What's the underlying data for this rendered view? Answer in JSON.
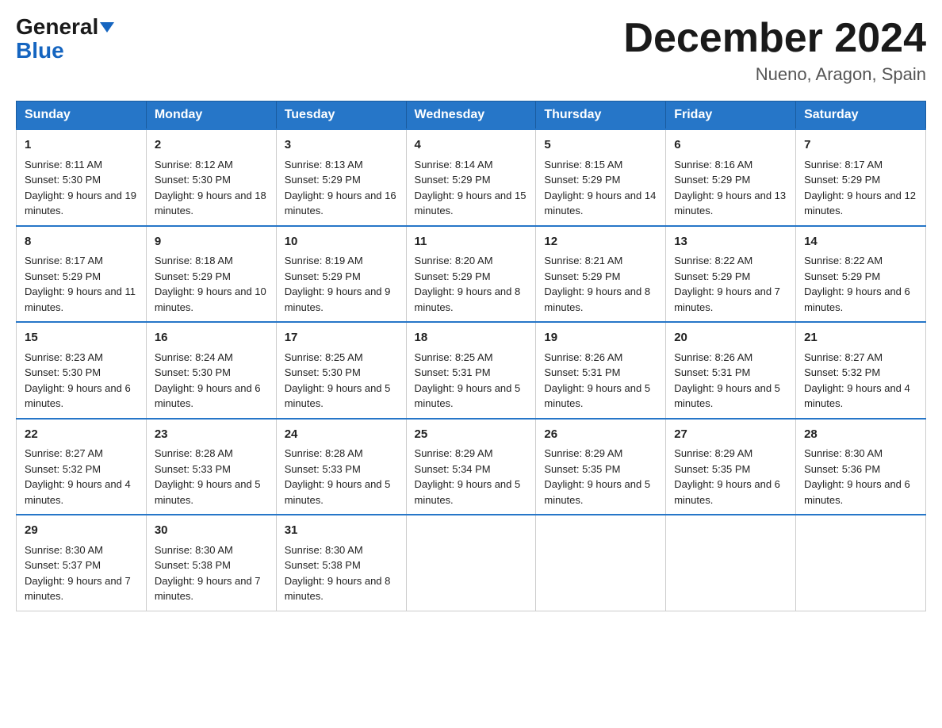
{
  "header": {
    "logo_general": "General",
    "logo_blue": "Blue",
    "title": "December 2024",
    "location": "Nueno, Aragon, Spain"
  },
  "days_of_week": [
    "Sunday",
    "Monday",
    "Tuesday",
    "Wednesday",
    "Thursday",
    "Friday",
    "Saturday"
  ],
  "weeks": [
    [
      {
        "day": "1",
        "sunrise": "Sunrise: 8:11 AM",
        "sunset": "Sunset: 5:30 PM",
        "daylight": "Daylight: 9 hours and 19 minutes."
      },
      {
        "day": "2",
        "sunrise": "Sunrise: 8:12 AM",
        "sunset": "Sunset: 5:30 PM",
        "daylight": "Daylight: 9 hours and 18 minutes."
      },
      {
        "day": "3",
        "sunrise": "Sunrise: 8:13 AM",
        "sunset": "Sunset: 5:29 PM",
        "daylight": "Daylight: 9 hours and 16 minutes."
      },
      {
        "day": "4",
        "sunrise": "Sunrise: 8:14 AM",
        "sunset": "Sunset: 5:29 PM",
        "daylight": "Daylight: 9 hours and 15 minutes."
      },
      {
        "day": "5",
        "sunrise": "Sunrise: 8:15 AM",
        "sunset": "Sunset: 5:29 PM",
        "daylight": "Daylight: 9 hours and 14 minutes."
      },
      {
        "day": "6",
        "sunrise": "Sunrise: 8:16 AM",
        "sunset": "Sunset: 5:29 PM",
        "daylight": "Daylight: 9 hours and 13 minutes."
      },
      {
        "day": "7",
        "sunrise": "Sunrise: 8:17 AM",
        "sunset": "Sunset: 5:29 PM",
        "daylight": "Daylight: 9 hours and 12 minutes."
      }
    ],
    [
      {
        "day": "8",
        "sunrise": "Sunrise: 8:17 AM",
        "sunset": "Sunset: 5:29 PM",
        "daylight": "Daylight: 9 hours and 11 minutes."
      },
      {
        "day": "9",
        "sunrise": "Sunrise: 8:18 AM",
        "sunset": "Sunset: 5:29 PM",
        "daylight": "Daylight: 9 hours and 10 minutes."
      },
      {
        "day": "10",
        "sunrise": "Sunrise: 8:19 AM",
        "sunset": "Sunset: 5:29 PM",
        "daylight": "Daylight: 9 hours and 9 minutes."
      },
      {
        "day": "11",
        "sunrise": "Sunrise: 8:20 AM",
        "sunset": "Sunset: 5:29 PM",
        "daylight": "Daylight: 9 hours and 8 minutes."
      },
      {
        "day": "12",
        "sunrise": "Sunrise: 8:21 AM",
        "sunset": "Sunset: 5:29 PM",
        "daylight": "Daylight: 9 hours and 8 minutes."
      },
      {
        "day": "13",
        "sunrise": "Sunrise: 8:22 AM",
        "sunset": "Sunset: 5:29 PM",
        "daylight": "Daylight: 9 hours and 7 minutes."
      },
      {
        "day": "14",
        "sunrise": "Sunrise: 8:22 AM",
        "sunset": "Sunset: 5:29 PM",
        "daylight": "Daylight: 9 hours and 6 minutes."
      }
    ],
    [
      {
        "day": "15",
        "sunrise": "Sunrise: 8:23 AM",
        "sunset": "Sunset: 5:30 PM",
        "daylight": "Daylight: 9 hours and 6 minutes."
      },
      {
        "day": "16",
        "sunrise": "Sunrise: 8:24 AM",
        "sunset": "Sunset: 5:30 PM",
        "daylight": "Daylight: 9 hours and 6 minutes."
      },
      {
        "day": "17",
        "sunrise": "Sunrise: 8:25 AM",
        "sunset": "Sunset: 5:30 PM",
        "daylight": "Daylight: 9 hours and 5 minutes."
      },
      {
        "day": "18",
        "sunrise": "Sunrise: 8:25 AM",
        "sunset": "Sunset: 5:31 PM",
        "daylight": "Daylight: 9 hours and 5 minutes."
      },
      {
        "day": "19",
        "sunrise": "Sunrise: 8:26 AM",
        "sunset": "Sunset: 5:31 PM",
        "daylight": "Daylight: 9 hours and 5 minutes."
      },
      {
        "day": "20",
        "sunrise": "Sunrise: 8:26 AM",
        "sunset": "Sunset: 5:31 PM",
        "daylight": "Daylight: 9 hours and 5 minutes."
      },
      {
        "day": "21",
        "sunrise": "Sunrise: 8:27 AM",
        "sunset": "Sunset: 5:32 PM",
        "daylight": "Daylight: 9 hours and 4 minutes."
      }
    ],
    [
      {
        "day": "22",
        "sunrise": "Sunrise: 8:27 AM",
        "sunset": "Sunset: 5:32 PM",
        "daylight": "Daylight: 9 hours and 4 minutes."
      },
      {
        "day": "23",
        "sunrise": "Sunrise: 8:28 AM",
        "sunset": "Sunset: 5:33 PM",
        "daylight": "Daylight: 9 hours and 5 minutes."
      },
      {
        "day": "24",
        "sunrise": "Sunrise: 8:28 AM",
        "sunset": "Sunset: 5:33 PM",
        "daylight": "Daylight: 9 hours and 5 minutes."
      },
      {
        "day": "25",
        "sunrise": "Sunrise: 8:29 AM",
        "sunset": "Sunset: 5:34 PM",
        "daylight": "Daylight: 9 hours and 5 minutes."
      },
      {
        "day": "26",
        "sunrise": "Sunrise: 8:29 AM",
        "sunset": "Sunset: 5:35 PM",
        "daylight": "Daylight: 9 hours and 5 minutes."
      },
      {
        "day": "27",
        "sunrise": "Sunrise: 8:29 AM",
        "sunset": "Sunset: 5:35 PM",
        "daylight": "Daylight: 9 hours and 6 minutes."
      },
      {
        "day": "28",
        "sunrise": "Sunrise: 8:30 AM",
        "sunset": "Sunset: 5:36 PM",
        "daylight": "Daylight: 9 hours and 6 minutes."
      }
    ],
    [
      {
        "day": "29",
        "sunrise": "Sunrise: 8:30 AM",
        "sunset": "Sunset: 5:37 PM",
        "daylight": "Daylight: 9 hours and 7 minutes."
      },
      {
        "day": "30",
        "sunrise": "Sunrise: 8:30 AM",
        "sunset": "Sunset: 5:38 PM",
        "daylight": "Daylight: 9 hours and 7 minutes."
      },
      {
        "day": "31",
        "sunrise": "Sunrise: 8:30 AM",
        "sunset": "Sunset: 5:38 PM",
        "daylight": "Daylight: 9 hours and 8 minutes."
      },
      null,
      null,
      null,
      null
    ]
  ]
}
